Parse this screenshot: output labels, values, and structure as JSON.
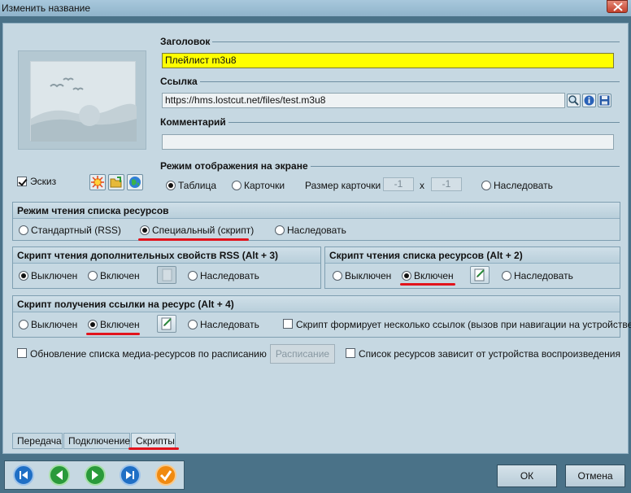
{
  "window": {
    "title": "Изменить название"
  },
  "fields": {
    "title_label": "Заголовок",
    "title_value": "Плейлист m3u8",
    "link_label": "Ссылка",
    "link_value": "https://hms.lostcut.net/files/test.m3u8",
    "comment_label": "Комментарий",
    "comment_value": ""
  },
  "thumbnail": {
    "checkbox_label": "Эскиз",
    "checked": true
  },
  "display_mode": {
    "label": "Режим отображения на экране",
    "options": [
      "Таблица",
      "Карточки",
      "Наследовать"
    ],
    "selected": "Таблица",
    "card_size_label": "Размер карточки",
    "card_w": "-1",
    "card_sep": "x",
    "card_h": "-1"
  },
  "read_mode": {
    "label": "Режим чтения списка ресурсов",
    "options": [
      "Стандартный (RSS)",
      "Специальный (скрипт)",
      "Наследовать"
    ],
    "selected": "Специальный (скрипт)"
  },
  "rss_script": {
    "label": "Скрипт чтения дополнительных свойств RSS (Alt + 3)",
    "options": [
      "Выключен",
      "Включен",
      "Наследовать"
    ],
    "selected": "Выключен"
  },
  "list_script": {
    "label": "Скрипт чтения списка ресурсов (Alt + 2)",
    "options": [
      "Выключен",
      "Включен",
      "Наследовать"
    ],
    "selected": "Включен"
  },
  "link_script": {
    "label": "Скрипт получения ссылки на ресурс (Alt + 4)",
    "options": [
      "Выключен",
      "Включен",
      "Наследовать"
    ],
    "selected": "Включен",
    "multi_label": "Скрипт формирует несколько ссылок (вызов при навигации на устройстве)"
  },
  "schedule": {
    "update_label": "Обновление списка медиа-ресурсов по расписанию",
    "button": "Расписание",
    "device_label": "Список ресурсов зависит от устройства воспроизведения"
  },
  "tabs": [
    "Передача",
    "Подключение",
    "Скрипты"
  ],
  "active_tab": "Скрипты",
  "buttons": {
    "ok": "ОК",
    "cancel": "Отмена"
  },
  "colors": {
    "title_field": "#ffff00",
    "highlight": "#e2131c",
    "nav_blue": "#1f6fc5",
    "nav_green": "#2a9a3a",
    "nav_orange": "#f08a10"
  }
}
